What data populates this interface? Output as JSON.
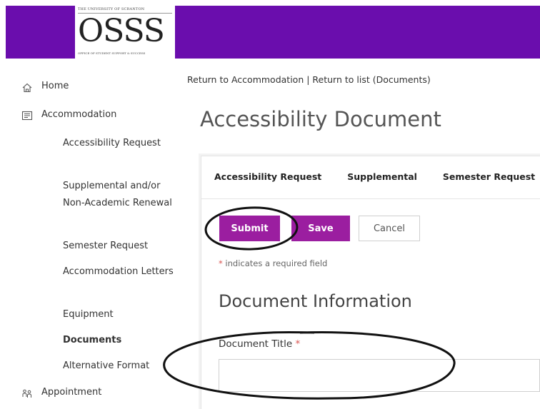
{
  "header": {
    "logo_top_text": "THE UNIVERSITY OF SCRANTON",
    "logo_main_text": "OSSS",
    "logo_bottom_text": "OFFICE OF STUDENT SUPPORT & SUCCESS",
    "brand_color": "#6a0dad"
  },
  "sidebar": {
    "home": {
      "label": "Home",
      "icon": "home-icon"
    },
    "accommodation": {
      "label": "Accommodation",
      "icon": "document-list-icon"
    },
    "items": [
      {
        "label": "Accessibility Request"
      },
      {
        "label": "Supplemental and/or Non-Academic Renewal"
      },
      {
        "label": "Semester Request"
      },
      {
        "label": "Accommodation Letters"
      },
      {
        "label": "Equipment"
      },
      {
        "label": "Documents",
        "active": true
      },
      {
        "label": "Alternative Format"
      }
    ],
    "appointment": {
      "label": "Appointment",
      "icon": "people-icon"
    }
  },
  "breadcrumb": {
    "link1": "Return to Accommodation",
    "separator": " | ",
    "link2": "Return to list (Documents)"
  },
  "page_title": "Accessibility Document",
  "tabs": [
    "Accessibility Request",
    "Supplemental",
    "Semester Request"
  ],
  "buttons": {
    "submit": "Submit",
    "save": "Save",
    "cancel": "Cancel",
    "primary_color": "#9b1ea0"
  },
  "required_note": {
    "star": "*",
    "text": " indicates a required field"
  },
  "section_title": "Document Information",
  "document_title_field": {
    "label": "Document Title",
    "required_star": "*",
    "value": ""
  }
}
